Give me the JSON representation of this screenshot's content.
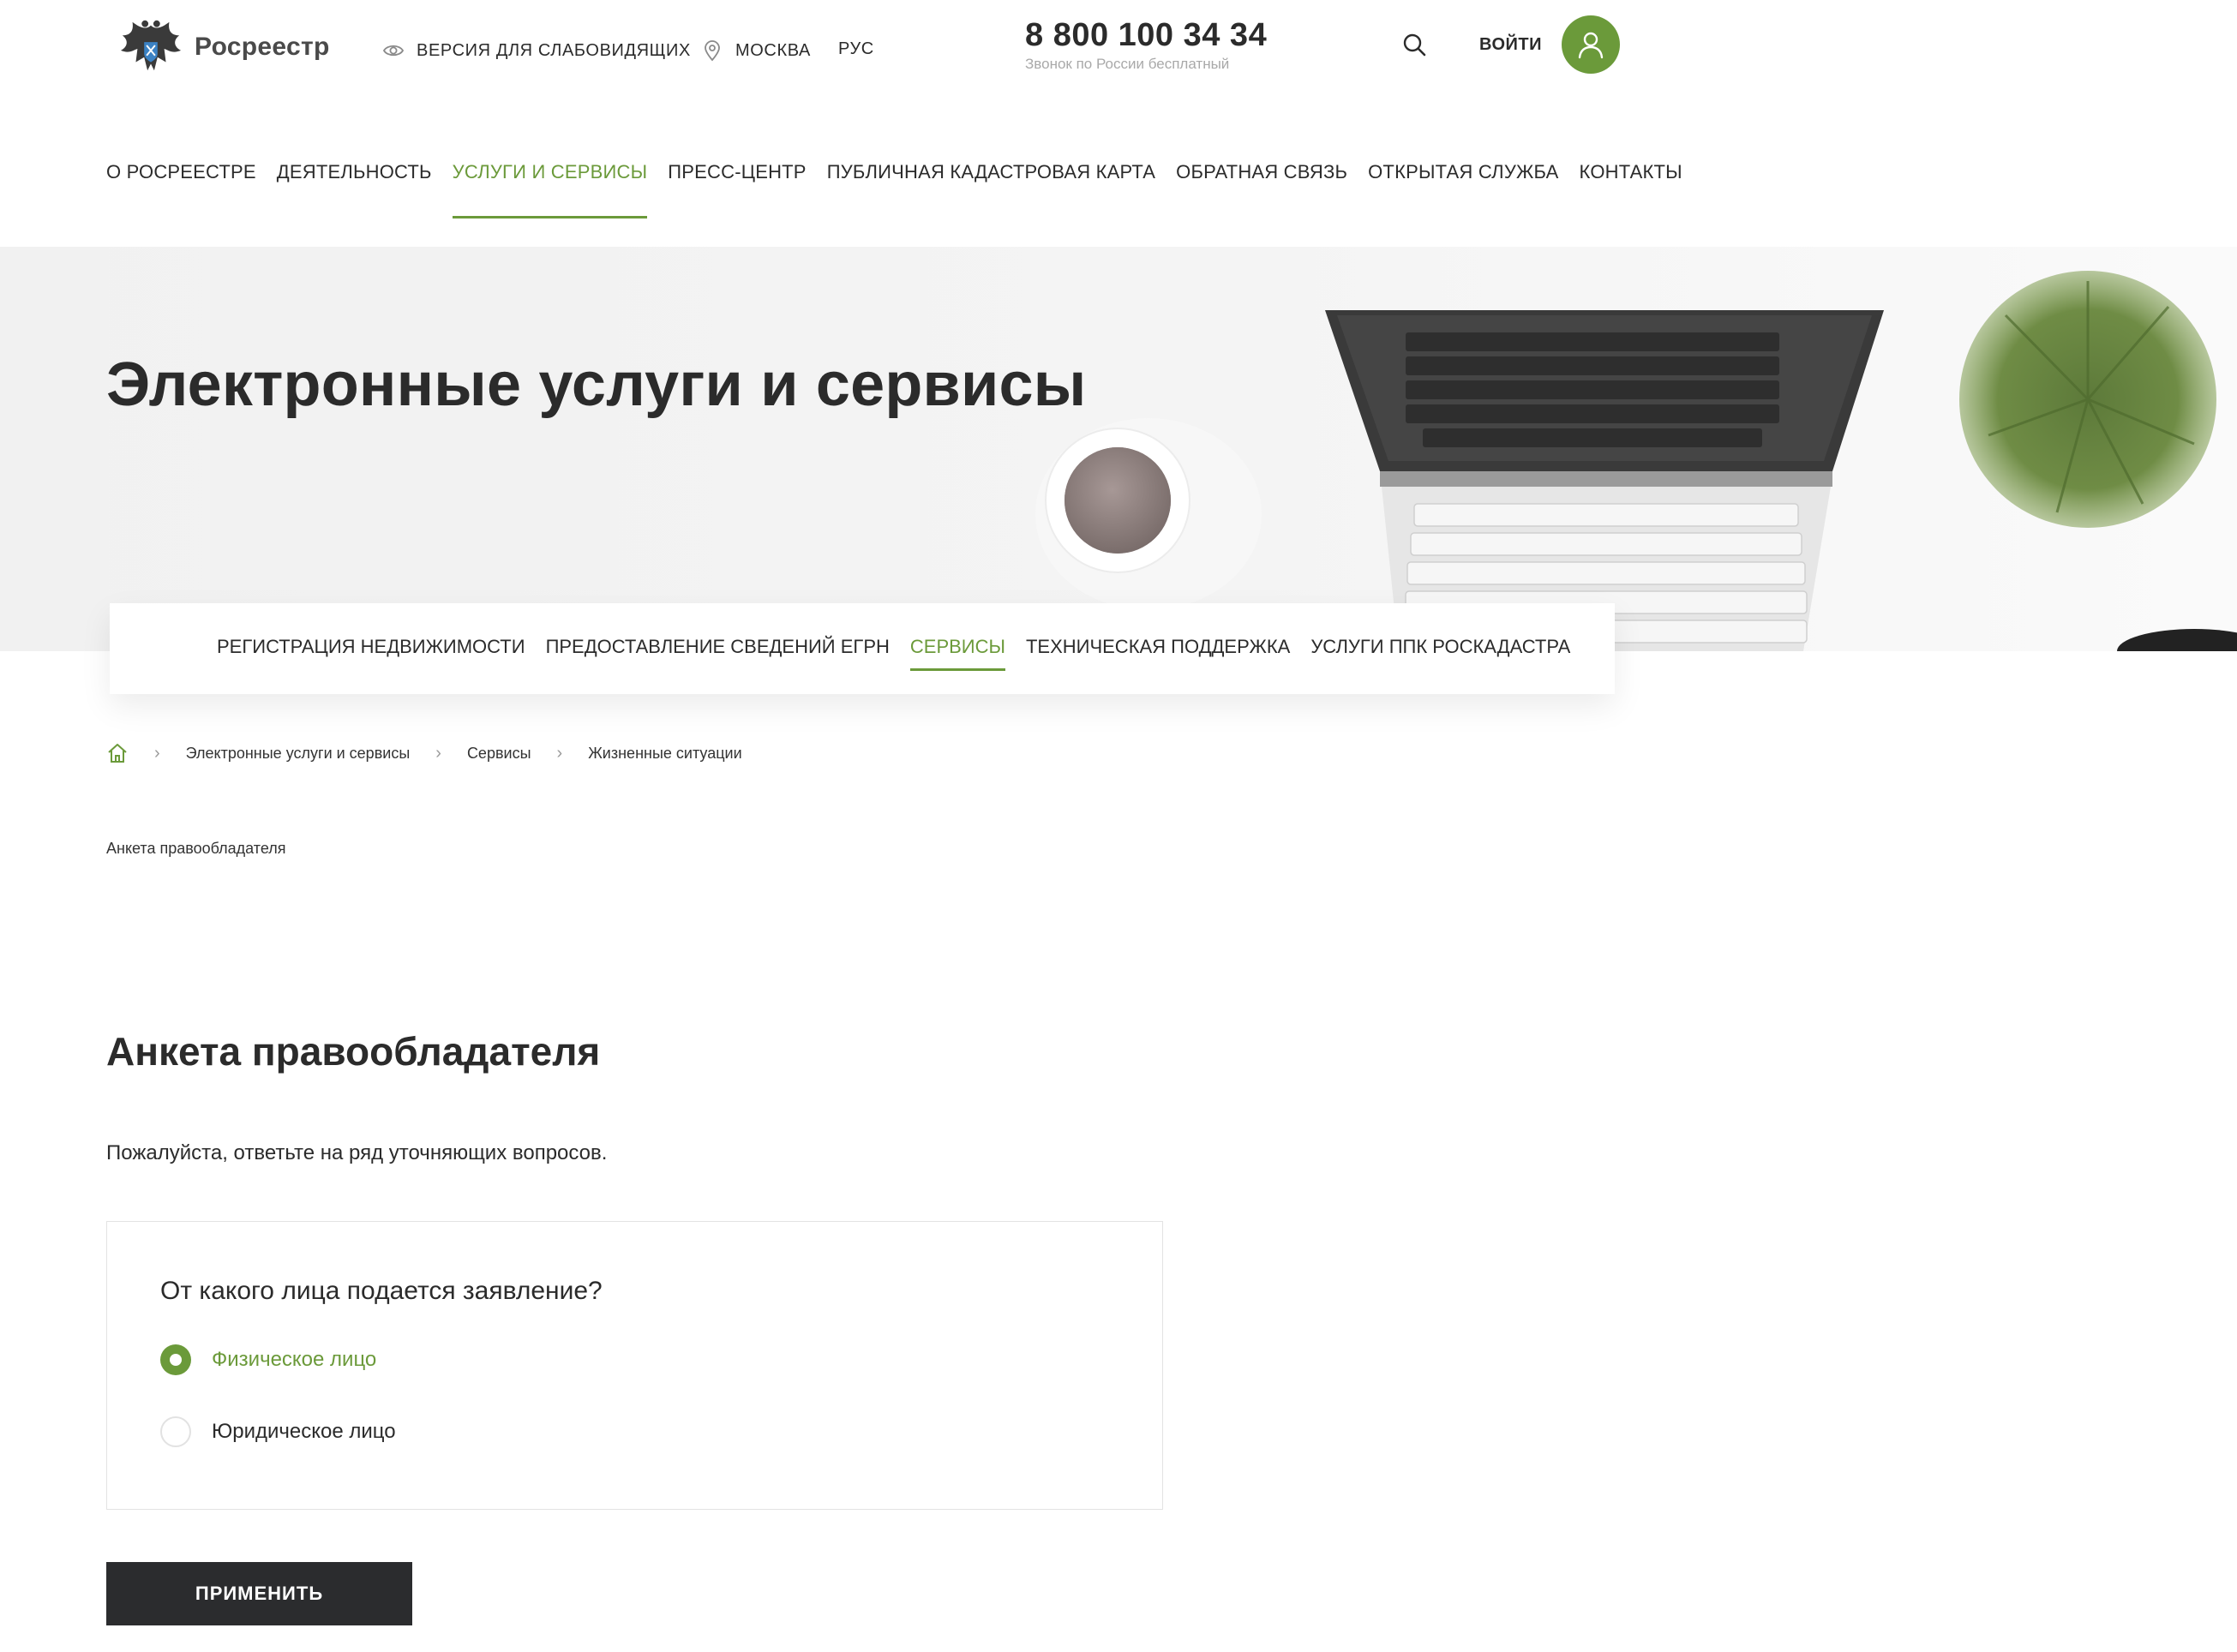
{
  "header": {
    "logo_text": "Росреестр",
    "accessibility_label": "ВЕРСИЯ ДЛЯ СЛАБОВИДЯЩИХ",
    "region_label": "МОСКВА",
    "language_label": "РУС",
    "phone": "8 800 100 34 34",
    "phone_note": "Звонок по России бесплатный",
    "login_label": "ВОЙТИ"
  },
  "main_nav": {
    "items": [
      {
        "label": "О РОСРЕЕСТРЕ"
      },
      {
        "label": "ДЕЯТЕЛЬНОСТЬ"
      },
      {
        "label": "УСЛУГИ И СЕРВИСЫ",
        "active": true
      },
      {
        "label": "ПРЕСС-ЦЕНТР"
      },
      {
        "label": "ПУБЛИЧНАЯ КАДАСТРОВАЯ КАРТА"
      },
      {
        "label": "ОБРАТНАЯ СВЯЗЬ"
      },
      {
        "label": "ОТКРЫТАЯ СЛУЖБА"
      },
      {
        "label": "КОНТАКТЫ"
      }
    ]
  },
  "hero": {
    "title": "Электронные услуги и сервисы"
  },
  "sub_nav": {
    "items": [
      {
        "label": "РЕГИСТРАЦИЯ НЕДВИЖИМОСТИ"
      },
      {
        "label": "ПРЕДОСТАВЛЕНИЕ СВЕДЕНИЙ ЕГРН"
      },
      {
        "label": "СЕРВИСЫ",
        "active": true
      },
      {
        "label": "ТЕХНИЧЕСКАЯ ПОДДЕРЖКА"
      },
      {
        "label": "УСЛУГИ ППК РОСКАДАСТРА"
      }
    ]
  },
  "breadcrumb": {
    "items": [
      "Электронные услуги и сервисы",
      "Сервисы",
      "Жизненные ситуации"
    ],
    "current": "Анкета правообладателя"
  },
  "content": {
    "title": "Анкета правообладателя",
    "intro": "Пожалуйста, ответьте на ряд уточняющих вопросов.",
    "question": "От какого лица подается заявление?",
    "options": [
      {
        "label": "Физическое лицо",
        "selected": true
      },
      {
        "label": "Юридическое лицо",
        "selected": false
      }
    ],
    "apply_label": "ПРИМЕНИТЬ"
  },
  "colors": {
    "accent": "#6b9a3a",
    "text": "#2b2b2b",
    "button_dark": "#2b2c2e"
  }
}
